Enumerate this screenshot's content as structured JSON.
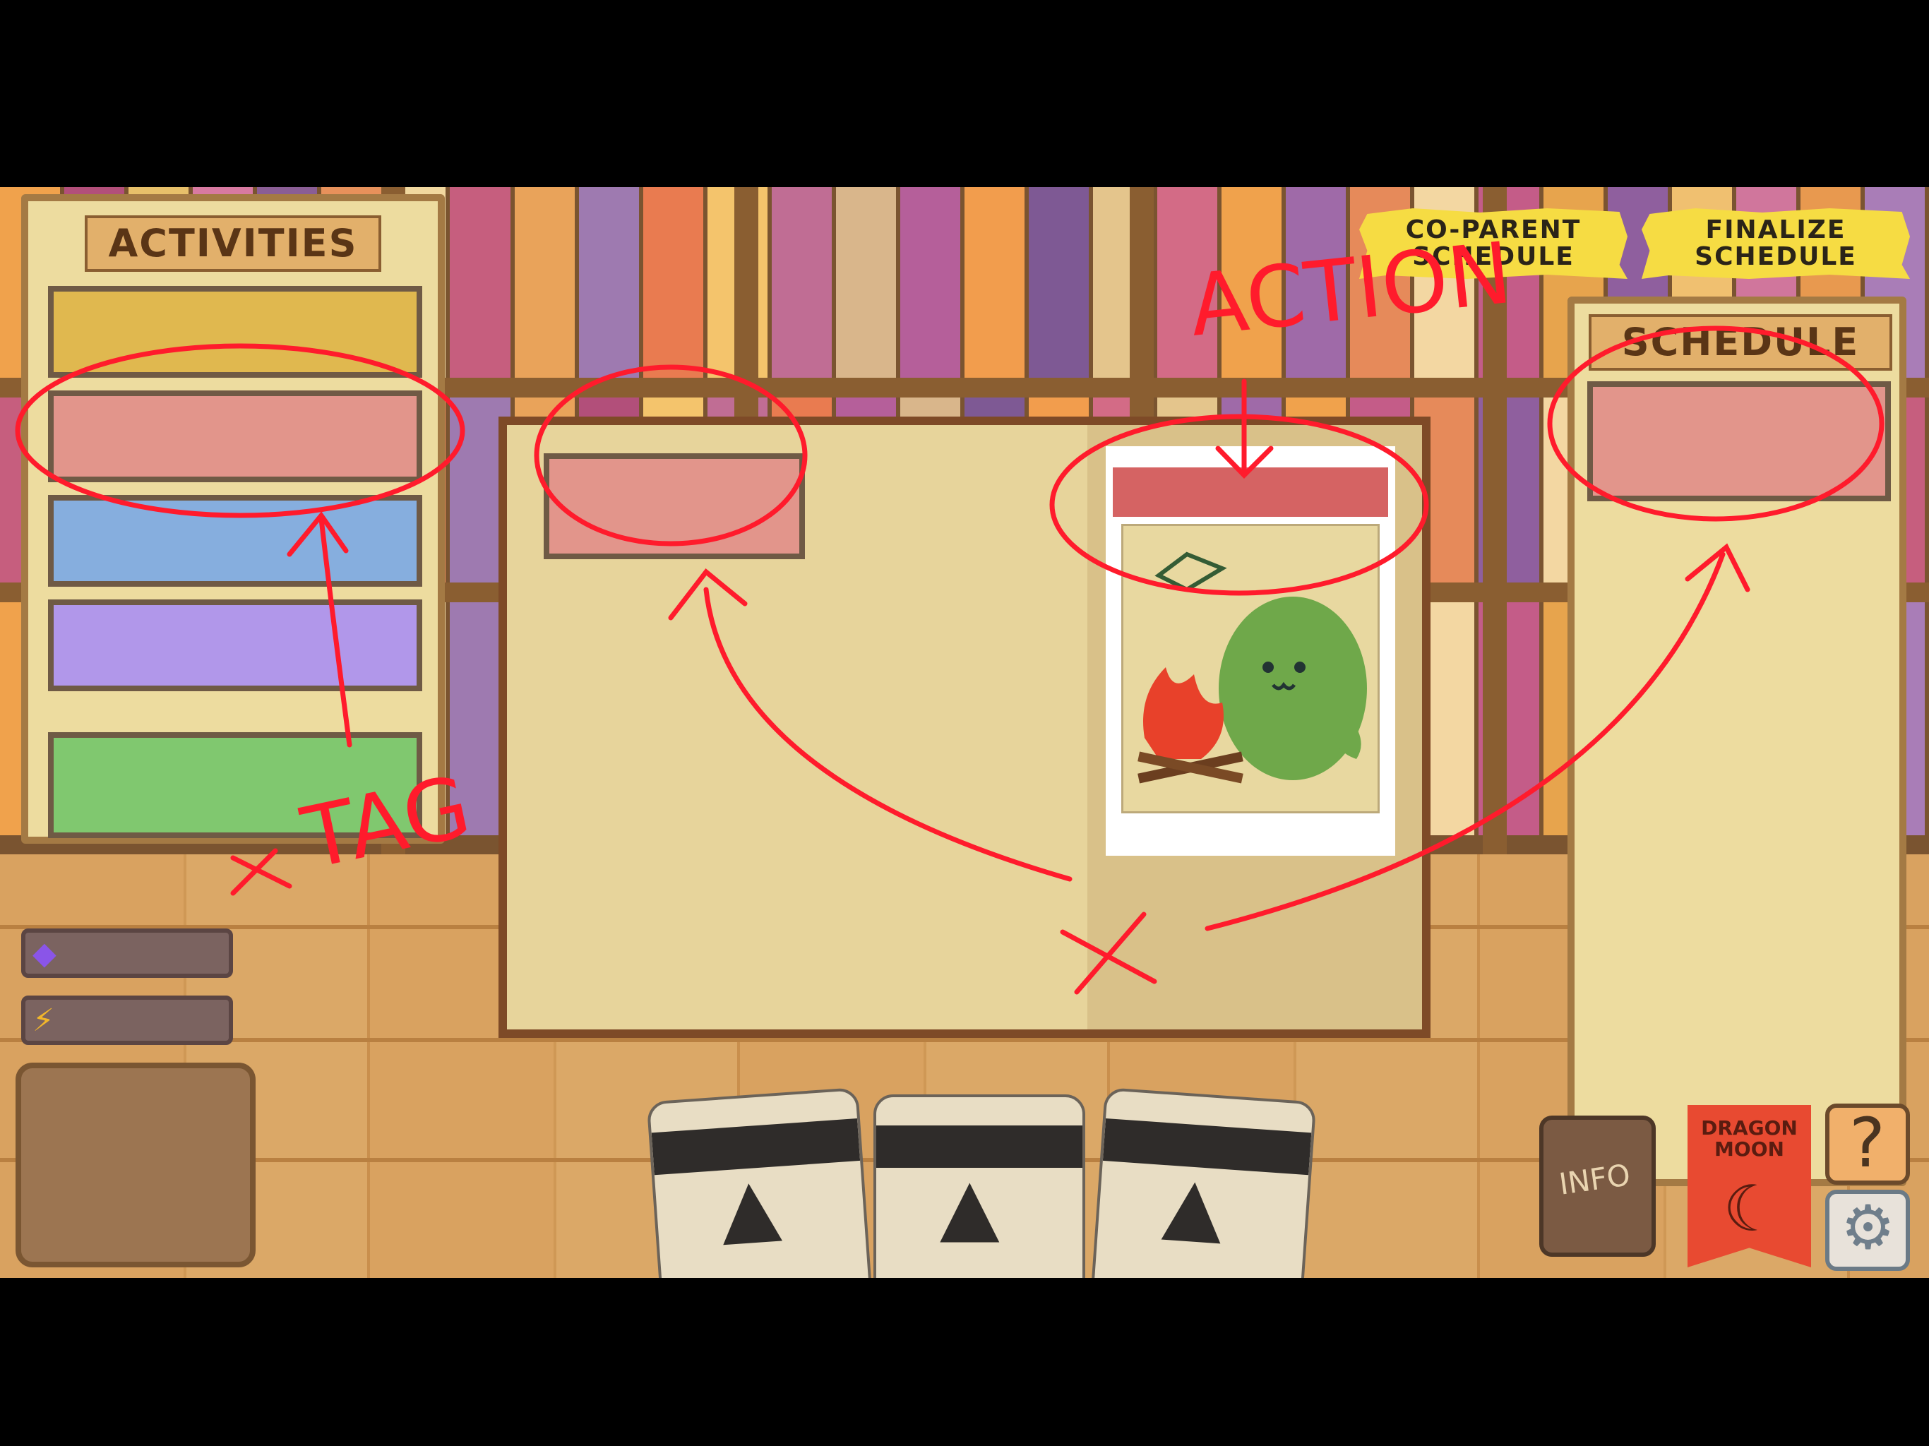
{
  "activities_panel": {
    "title": "ACTIVITIES",
    "tag_colors": [
      "#e0b84f",
      "#e2958b",
      "#86aede",
      "#b197ea",
      "#80c86f"
    ]
  },
  "resources": [
    {
      "icon": "purple-gem-icon",
      "color": "#8a55e8"
    },
    {
      "icon": "lightning-icon",
      "color": "#f1b62b"
    }
  ],
  "buttons": {
    "co_parent": "CO-PARENT\nSCHEDULE",
    "finalize": "FINALIZE\nSCHEDULE",
    "info": "INFO",
    "help": "?",
    "dragon_moon": "DRAGON\nMOON"
  },
  "schedule_panel": {
    "title": "SCHEDULE",
    "slot_color": "#e2958b"
  },
  "book": {
    "left_tag_color": "#e2958b",
    "action_bar_color": "#d56363"
  },
  "annotations": {
    "action": "ACTION",
    "tag": "TAG",
    "ink_color": "#ff1b2c"
  },
  "hand_cards": 3
}
